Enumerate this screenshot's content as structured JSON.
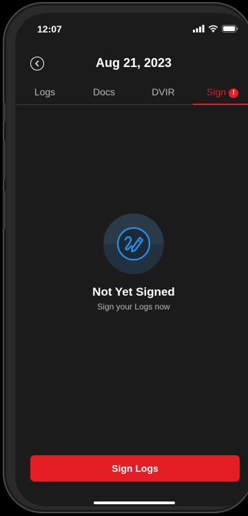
{
  "status_bar": {
    "time": "12:07"
  },
  "header": {
    "title": "Aug 21, 2023",
    "back_icon": "chevron-left-circle-icon"
  },
  "tabs": [
    {
      "label": "Logs",
      "active": false
    },
    {
      "label": "Docs",
      "active": false
    },
    {
      "label": "DVIR",
      "active": false
    },
    {
      "label": "Sign",
      "active": true,
      "badge": "!"
    }
  ],
  "empty_state": {
    "icon": "signature-pen-icon",
    "title": "Not Yet Signed",
    "subtitle": "Sign your Logs now"
  },
  "primary_action": {
    "label": "Sign Logs"
  },
  "colors": {
    "accent": "#e51d24",
    "background": "#1b1b1b",
    "icon_blue": "#2b8ee8"
  }
}
